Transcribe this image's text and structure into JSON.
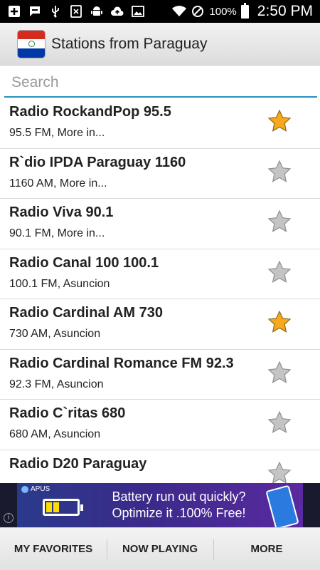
{
  "status_bar": {
    "icons": [
      "add-box-icon",
      "chat-icon",
      "usb-icon",
      "nfc-icon",
      "android-icon",
      "cloud-upload-icon",
      "image-icon"
    ],
    "right_icons": [
      "wifi-icon",
      "do-not-disturb-icon",
      "battery-icon"
    ],
    "battery": "100%",
    "time": "2:50 PM"
  },
  "app_bar": {
    "icon": "paraguay-flag-icon",
    "title": "Stations from Paraguay"
  },
  "search": {
    "placeholder": "Search",
    "value": ""
  },
  "stations": [
    {
      "name": "Radio RockandPop 95.5",
      "info": "95.5 FM, More in...",
      "favorite": true
    },
    {
      "name": "R`dio IPDA Paraguay 1160",
      "info": "1160 AM, More in...",
      "favorite": false
    },
    {
      "name": "Radio Viva 90.1",
      "info": "90.1 FM, More in...",
      "favorite": false
    },
    {
      "name": "Radio Canal 100 100.1",
      "info": "100.1 FM, Asuncion",
      "favorite": false
    },
    {
      "name": "Radio Cardinal AM 730",
      "info": "730 AM, Asuncion",
      "favorite": true
    },
    {
      "name": "Radio Cardinal Romance FM 92.3",
      "info": "92.3 FM, Asuncion",
      "favorite": false
    },
    {
      "name": "Radio C`ritas 680",
      "info": "680 AM, Asuncion",
      "favorite": false
    },
    {
      "name": "Radio D20 Paraguay",
      "info": "",
      "favorite": false
    }
  ],
  "ad": {
    "brand": "APUS",
    "line1": "Battery run out quickly?",
    "line2": "Optimize it .100% Free!",
    "info_icon": "i"
  },
  "bottom_nav": {
    "favorites": "MY FAVORITES",
    "now_playing": "NOW PLAYING",
    "more": "MORE"
  },
  "colors": {
    "favorite_star": "#f7a81b",
    "empty_star": "#bfbfbf",
    "search_underline": "#2a8fbf"
  }
}
